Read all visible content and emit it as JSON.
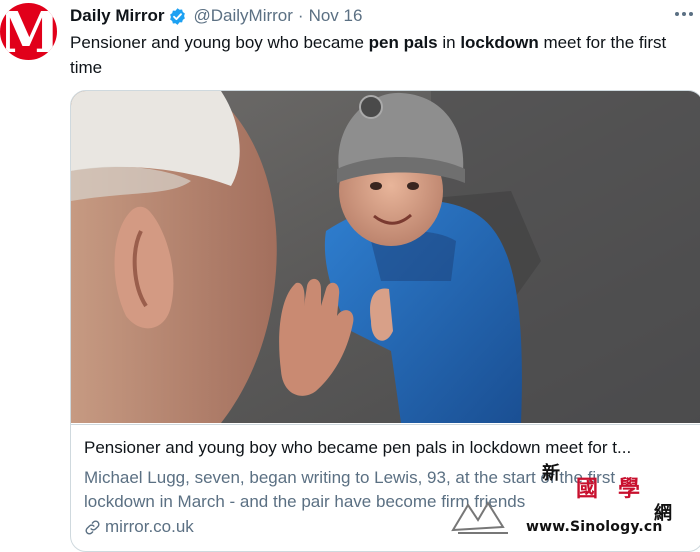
{
  "tweet": {
    "avatar": {
      "letter": "M",
      "color": "#e1001a"
    },
    "author_name": "Daily Mirror",
    "handle": "@DailyMirror",
    "separator": "·",
    "date": "Nov 16",
    "text": {
      "part1": "Pensioner and young boy who became ",
      "bold1": "pen pals",
      "part2": " in ",
      "bold2": "lockdown",
      "part3": " meet for the first time"
    }
  },
  "card": {
    "image_icon": "photo-of-elderly-man-and-boy-touching-hands-through-window",
    "title": "Pensioner and young boy who became pen pals in lockdown meet for t...",
    "description": "Michael Lugg, seven, began writing to Lewis, 93, at the start of the first lockdown in March - and the pair have become firm friends",
    "domain": "mirror.co.uk"
  },
  "watermark": {
    "char1": "新",
    "char2": "國",
    "char3": "學",
    "char4": "網",
    "url": "www.Sinology.cn"
  },
  "colors": {
    "text": "#0f1419",
    "secondary": "#5b7083",
    "verified": "#1da1f2",
    "border": "#cfd9de",
    "brand": "#e1001a"
  }
}
